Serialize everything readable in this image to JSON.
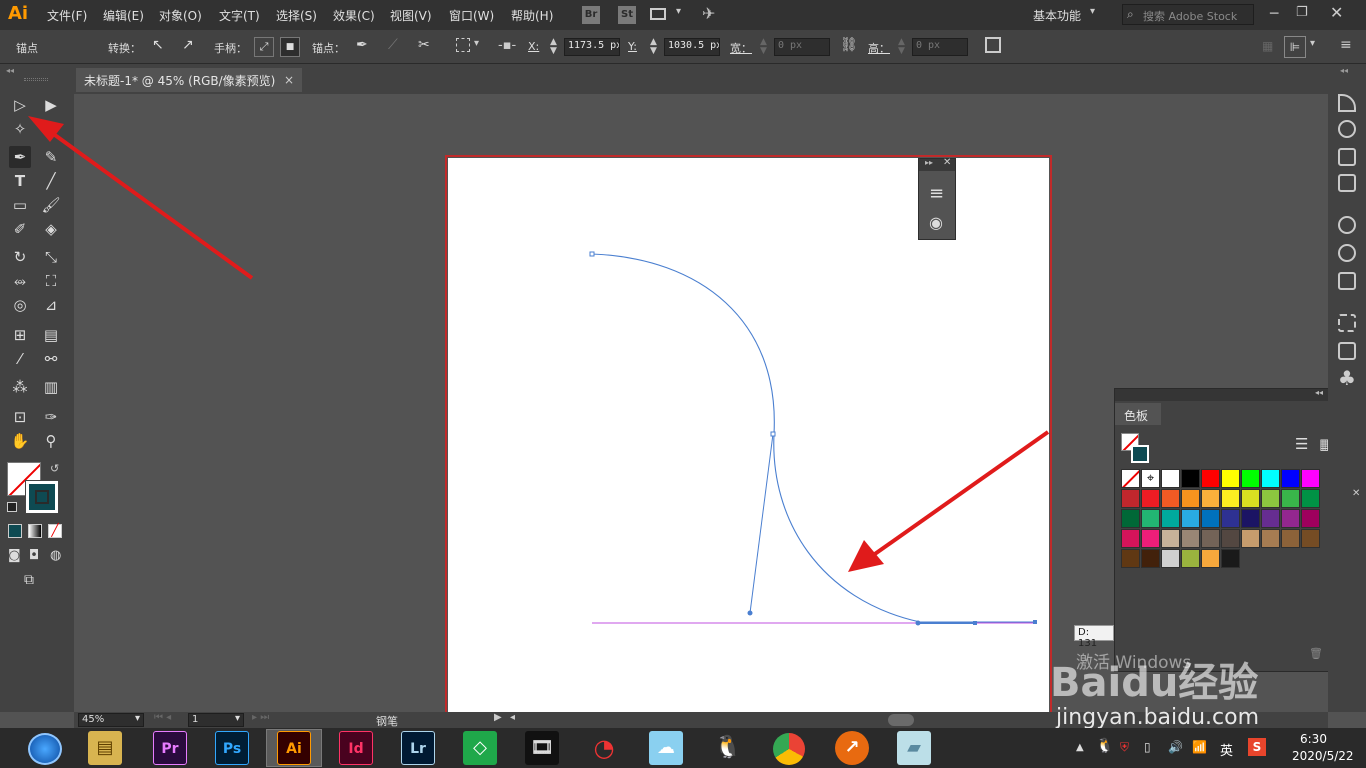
{
  "app": {
    "logo": "Ai"
  },
  "menus": [
    "文件(F)",
    "编辑(E)",
    "对象(O)",
    "文字(T)",
    "选择(S)",
    "效果(C)",
    "视图(V)",
    "窗口(W)",
    "帮助(H)"
  ],
  "bridge_buttons": [
    "Br",
    "St"
  ],
  "workspace": "基本功能",
  "search": {
    "placeholder": "搜索 Adobe Stock"
  },
  "control": {
    "anchor_label": "锚点",
    "convert_label": "转换：",
    "handle_label": "手柄：",
    "anchor_points_label": "锚点：",
    "x_label": "X:",
    "x_value": "1173.5 px",
    "y_label": "Y:",
    "y_value": "1030.5 px",
    "width_label": "宽：",
    "width_value": "0 px",
    "height_label": "高：",
    "height_value": "0 px"
  },
  "document_tab": {
    "title": "未标题-1* @ 45% (RGB/像素预览)",
    "close": "×"
  },
  "swatches_panel": {
    "title": "色板",
    "colors": [
      "#ffffff",
      "#000000",
      "#ff0000",
      "#ffff00",
      "#00ff00",
      "#00ffff",
      "#0000ff",
      "#ff00ff",
      "#c1272d",
      "#ed1c24",
      "#f15a24",
      "#f7931e",
      "#fbb03b",
      "#fcee21",
      "#d9e021",
      "#8cc63f",
      "#39b54a",
      "#009245",
      "#006837",
      "#22b573",
      "#00a99d",
      "#29abe2",
      "#0071bc",
      "#2e3192",
      "#1b1464",
      "#662d91",
      "#93278f",
      "#9e005d",
      "#d4145a",
      "#ed1e79",
      "#c7b299",
      "#998675",
      "#736357",
      "#534741",
      "#c69c6d",
      "#a67c52",
      "#8c6239",
      "#754c24",
      "#603813",
      "#42210b",
      "#d0d0d0",
      "#9ab33e",
      "#f7a83c",
      "#1a1a1a"
    ]
  },
  "distance_tooltip": "D: 131",
  "status": {
    "zoom": "45%",
    "page": "1",
    "tool": "钢笔"
  },
  "watermark": {
    "activate": "激活 Windows",
    "site": "jingyan.baidu.com",
    "brand": "Baidu经验"
  },
  "taskbar": {
    "apps": [
      {
        "label": "Pr",
        "color": "#2a0b3d",
        "fg": "#e77cff"
      },
      {
        "label": "Ps",
        "color": "#001d34",
        "fg": "#31a8ff"
      },
      {
        "label": "Ai",
        "color": "#330000",
        "fg": "#ff9a00"
      },
      {
        "label": "Id",
        "color": "#49021f",
        "fg": "#ff3366"
      },
      {
        "label": "Lr",
        "color": "#001a33",
        "fg": "#add5ec"
      }
    ],
    "ime": "英",
    "time": "6:30",
    "date": "2020/5/22"
  }
}
